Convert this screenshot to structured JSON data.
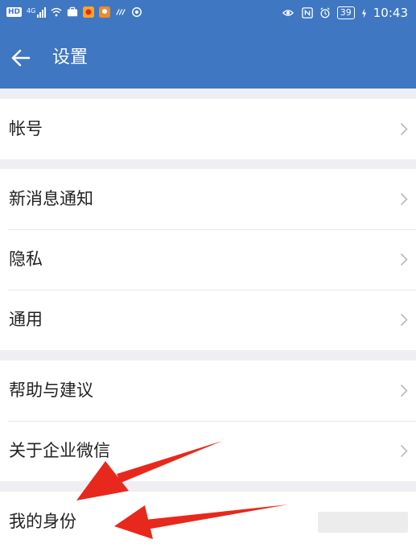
{
  "status_bar": {
    "network_badge": "HD",
    "signal_label": "4G",
    "battery": "39",
    "time": "10:43"
  },
  "header": {
    "title": "设置",
    "back_icon": "arrow-left-icon"
  },
  "groups": [
    {
      "items": [
        {
          "label": "帐号"
        }
      ]
    },
    {
      "items": [
        {
          "label": "新消息通知"
        },
        {
          "label": "隐私"
        },
        {
          "label": "通用"
        }
      ]
    },
    {
      "items": [
        {
          "label": "帮助与建议"
        },
        {
          "label": "关于企业微信"
        }
      ]
    },
    {
      "items": [
        {
          "label": "我的身份"
        }
      ]
    }
  ],
  "colors": {
    "header_blue": "#3f77c2",
    "background": "#efeff3",
    "annotation_red": "#e8281c"
  },
  "annotations": [
    "red-arrow-icon",
    "red-arrow-icon"
  ]
}
